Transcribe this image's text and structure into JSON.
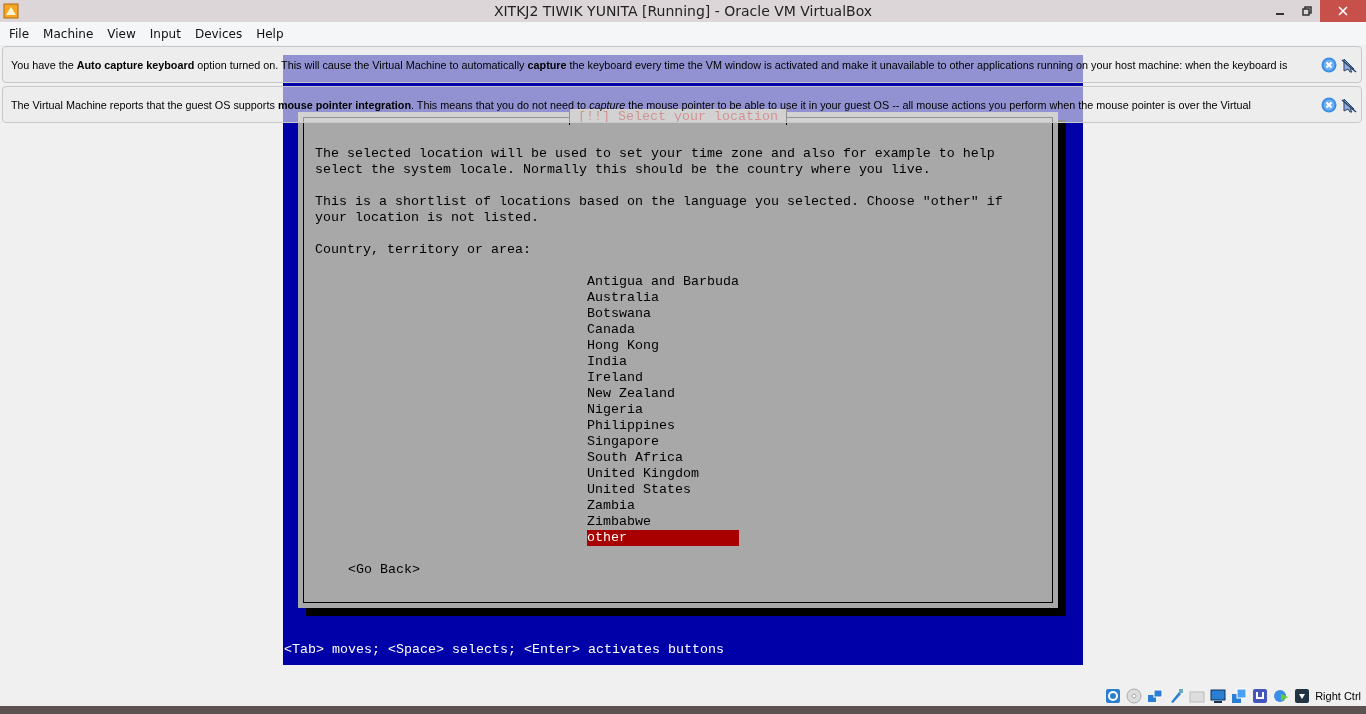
{
  "window": {
    "title": "XITKJ2 TIWIK YUNITA [Running] - Oracle VM VirtualBox"
  },
  "menu": [
    "File",
    "Machine",
    "View",
    "Input",
    "Devices",
    "Help"
  ],
  "notifications": [
    {
      "text": "You have the **Auto capture keyboard** option turned on. This will cause the Virtual Machine to automatically **capture** the keyboard every time the VM window is activated and make it unavailable to other applications running on your host machine: when the keyboard is"
    },
    {
      "text": "The Virtual Machine reports that the guest OS supports **mouse pointer integration**. This means that you do not need to *capture* the mouse pointer to be able to use it in your guest OS -- all mouse actions you perform when the mouse pointer is over the Virtual"
    }
  ],
  "installer": {
    "title": "[!!] Select your location",
    "paragraphs": [
      "The selected location will be used to set your time zone and also for example to help select the system locale. Normally this should be the country where you live.",
      "This is a shortlist of locations based on the language you selected. Choose \"other\" if your location is not listed."
    ],
    "prompt": "Country, territory or area:",
    "options": [
      {
        "label": "Antigua and Barbuda",
        "selected": false
      },
      {
        "label": "Australia",
        "selected": false
      },
      {
        "label": "Botswana",
        "selected": false
      },
      {
        "label": "Canada",
        "selected": false
      },
      {
        "label": "Hong Kong",
        "selected": false
      },
      {
        "label": "India",
        "selected": false
      },
      {
        "label": "Ireland",
        "selected": false
      },
      {
        "label": "New Zealand",
        "selected": false
      },
      {
        "label": "Nigeria",
        "selected": false
      },
      {
        "label": "Philippines",
        "selected": false
      },
      {
        "label": "Singapore",
        "selected": false
      },
      {
        "label": "South Africa",
        "selected": false
      },
      {
        "label": "United Kingdom",
        "selected": false
      },
      {
        "label": "United States",
        "selected": false
      },
      {
        "label": "Zambia",
        "selected": false
      },
      {
        "label": "Zimbabwe",
        "selected": false
      },
      {
        "label": "other",
        "selected": true
      }
    ],
    "back_button": "<Go Back>",
    "help_line": "<Tab> moves; <Space> selects; <Enter> activates buttons"
  },
  "status_bar": {
    "host_key": "Right Ctrl"
  }
}
